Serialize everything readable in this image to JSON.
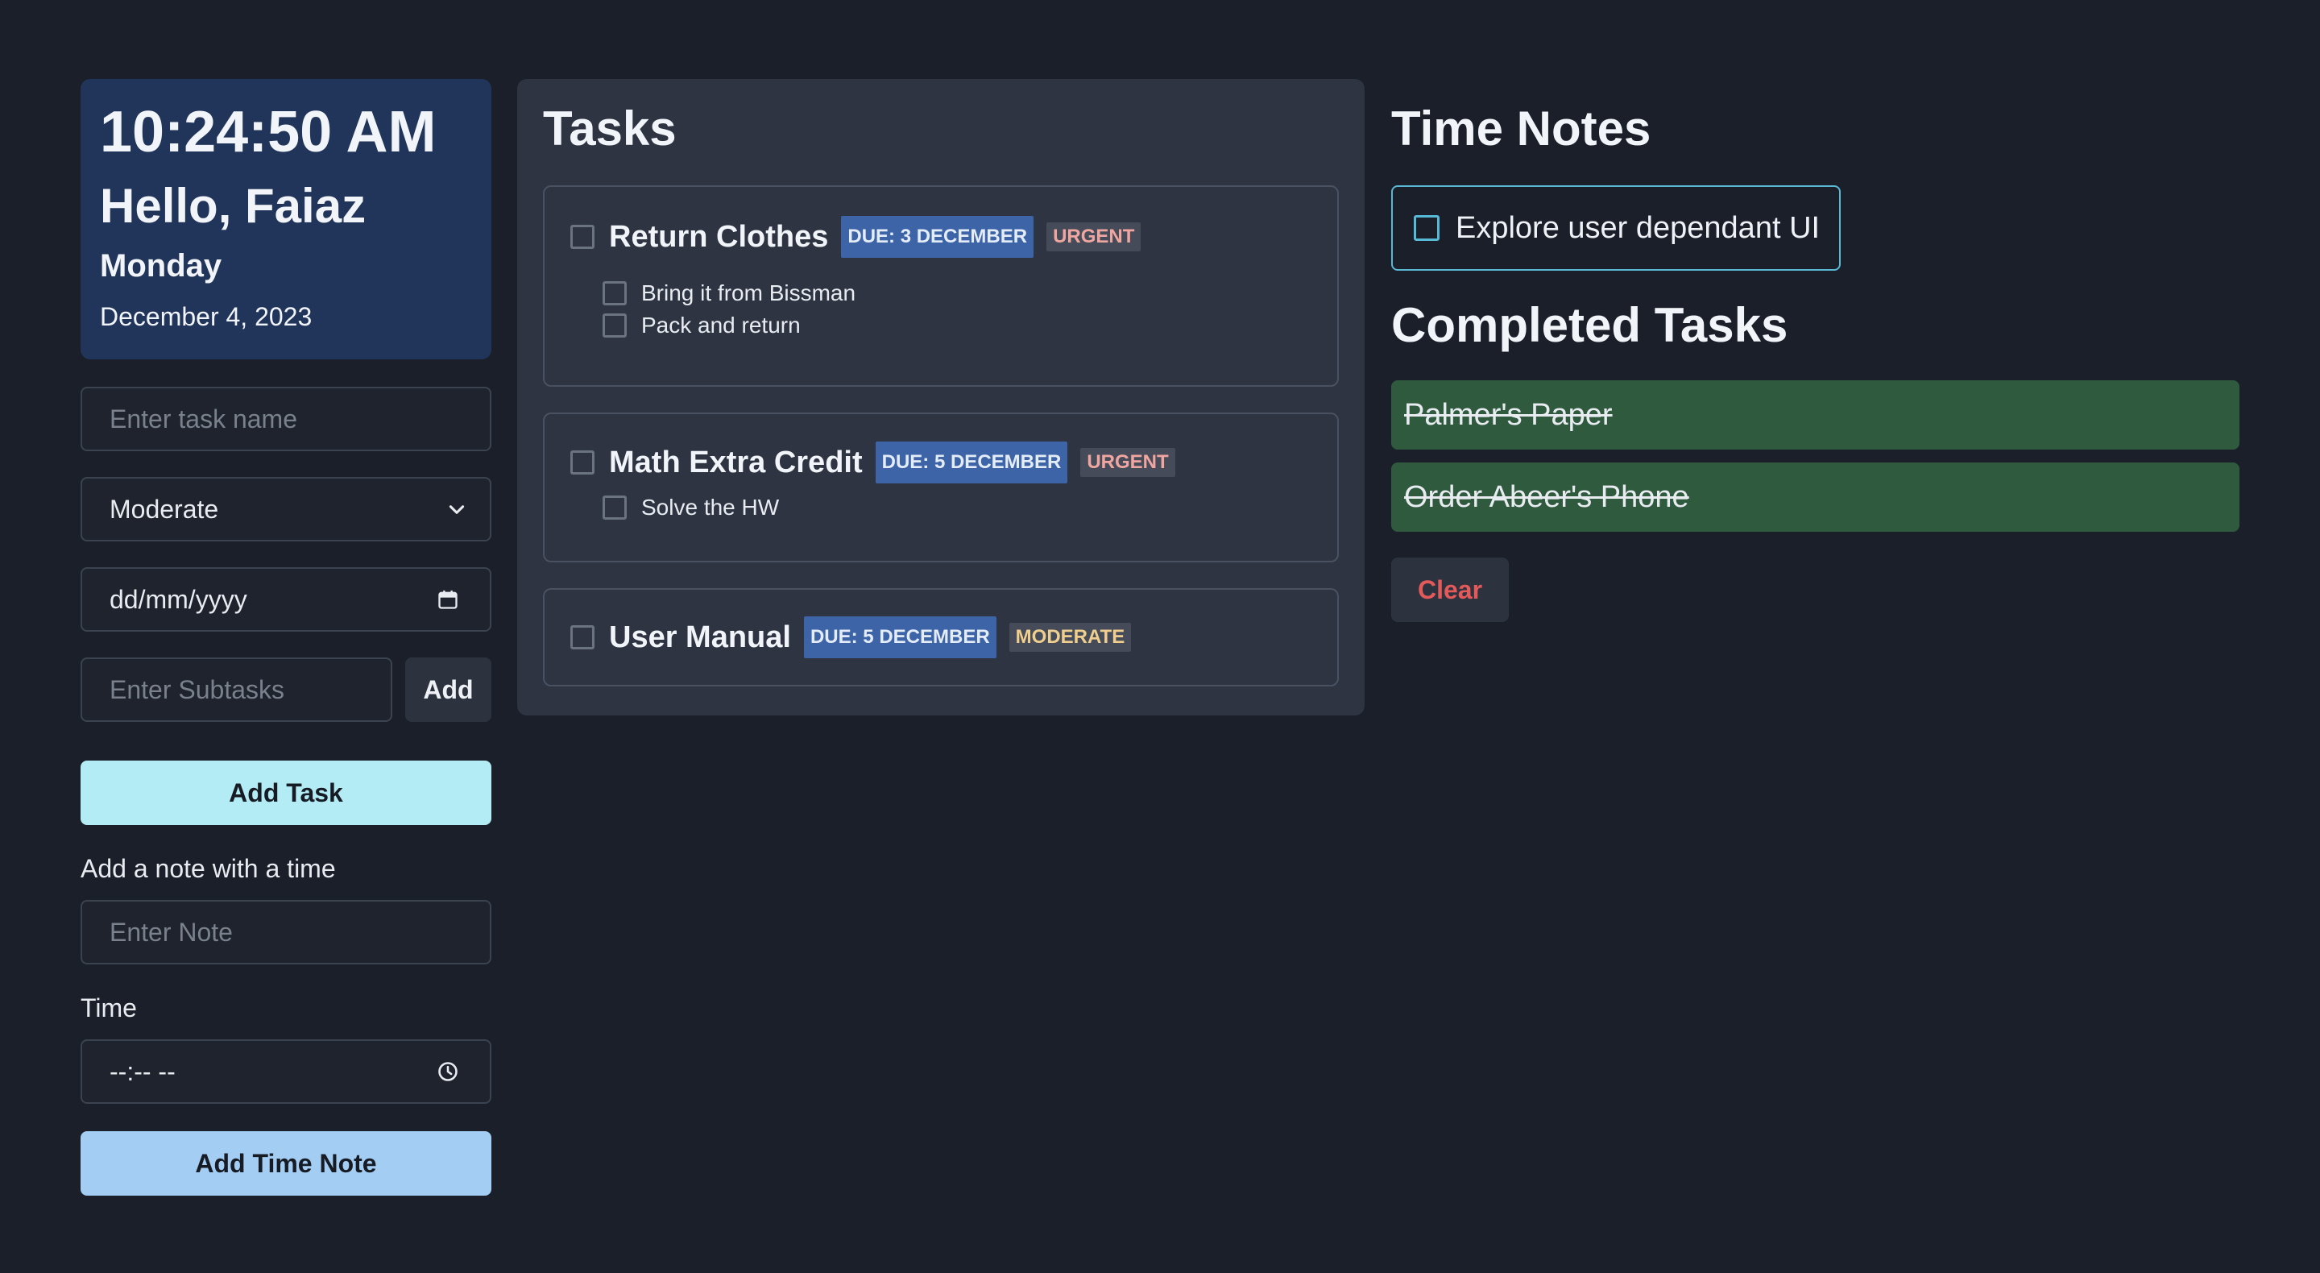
{
  "clock": {
    "time": "10:24:50 AM",
    "greeting": "Hello, Faiaz",
    "weekday": "Monday",
    "date": "December 4, 2023"
  },
  "form": {
    "task_name_placeholder": "Enter task name",
    "priority_selected": "Moderate",
    "date_placeholder": "dd/mm/yyyy",
    "subtask_placeholder": "Enter Subtasks",
    "add_subtask_label": "Add",
    "add_task_label": "Add Task",
    "note_label": "Add a note with a time",
    "note_placeholder": "Enter Note",
    "time_label": "Time",
    "time_placeholder": "--:-- --",
    "add_time_note_label": "Add Time Note"
  },
  "tasks_panel": {
    "title": "Tasks",
    "tasks": [
      {
        "title": "Return Clothes",
        "due": "DUE: 3 DECEMBER",
        "priority": "URGENT",
        "subtasks": [
          "Bring it from Bissman",
          "Pack and return"
        ]
      },
      {
        "title": "Math Extra Credit",
        "due": "DUE: 5 DECEMBER",
        "priority": "URGENT",
        "subtasks": [
          "Solve the HW"
        ]
      },
      {
        "title": "User Manual",
        "due": "DUE: 5 DECEMBER",
        "priority": "MODERATE",
        "subtasks": []
      }
    ]
  },
  "time_notes": {
    "title": "Time Notes",
    "items": [
      "Explore user dependant UI"
    ]
  },
  "completed": {
    "title": "Completed Tasks",
    "items": [
      "Palmer's Paper",
      "Order Abeer's Phone"
    ],
    "clear_label": "Clear"
  },
  "colors": {
    "background": "#1a1f29",
    "clock_card": "#21345a",
    "panel": "#2e3442",
    "due_badge": "#3c64a7",
    "urgent_text": "#f0a6a0",
    "moderate_text": "#f0cf8e",
    "completed_item": "#2f5a3e",
    "add_task_button": "#b4ecf5",
    "add_time_note_button": "#a3cdf2",
    "clear_text": "#e4595a",
    "note_border": "#5ab8d4"
  },
  "icons": {
    "priority_select": "chevron-down-icon",
    "date_input": "calendar-icon",
    "time_input": "clock-icon"
  }
}
